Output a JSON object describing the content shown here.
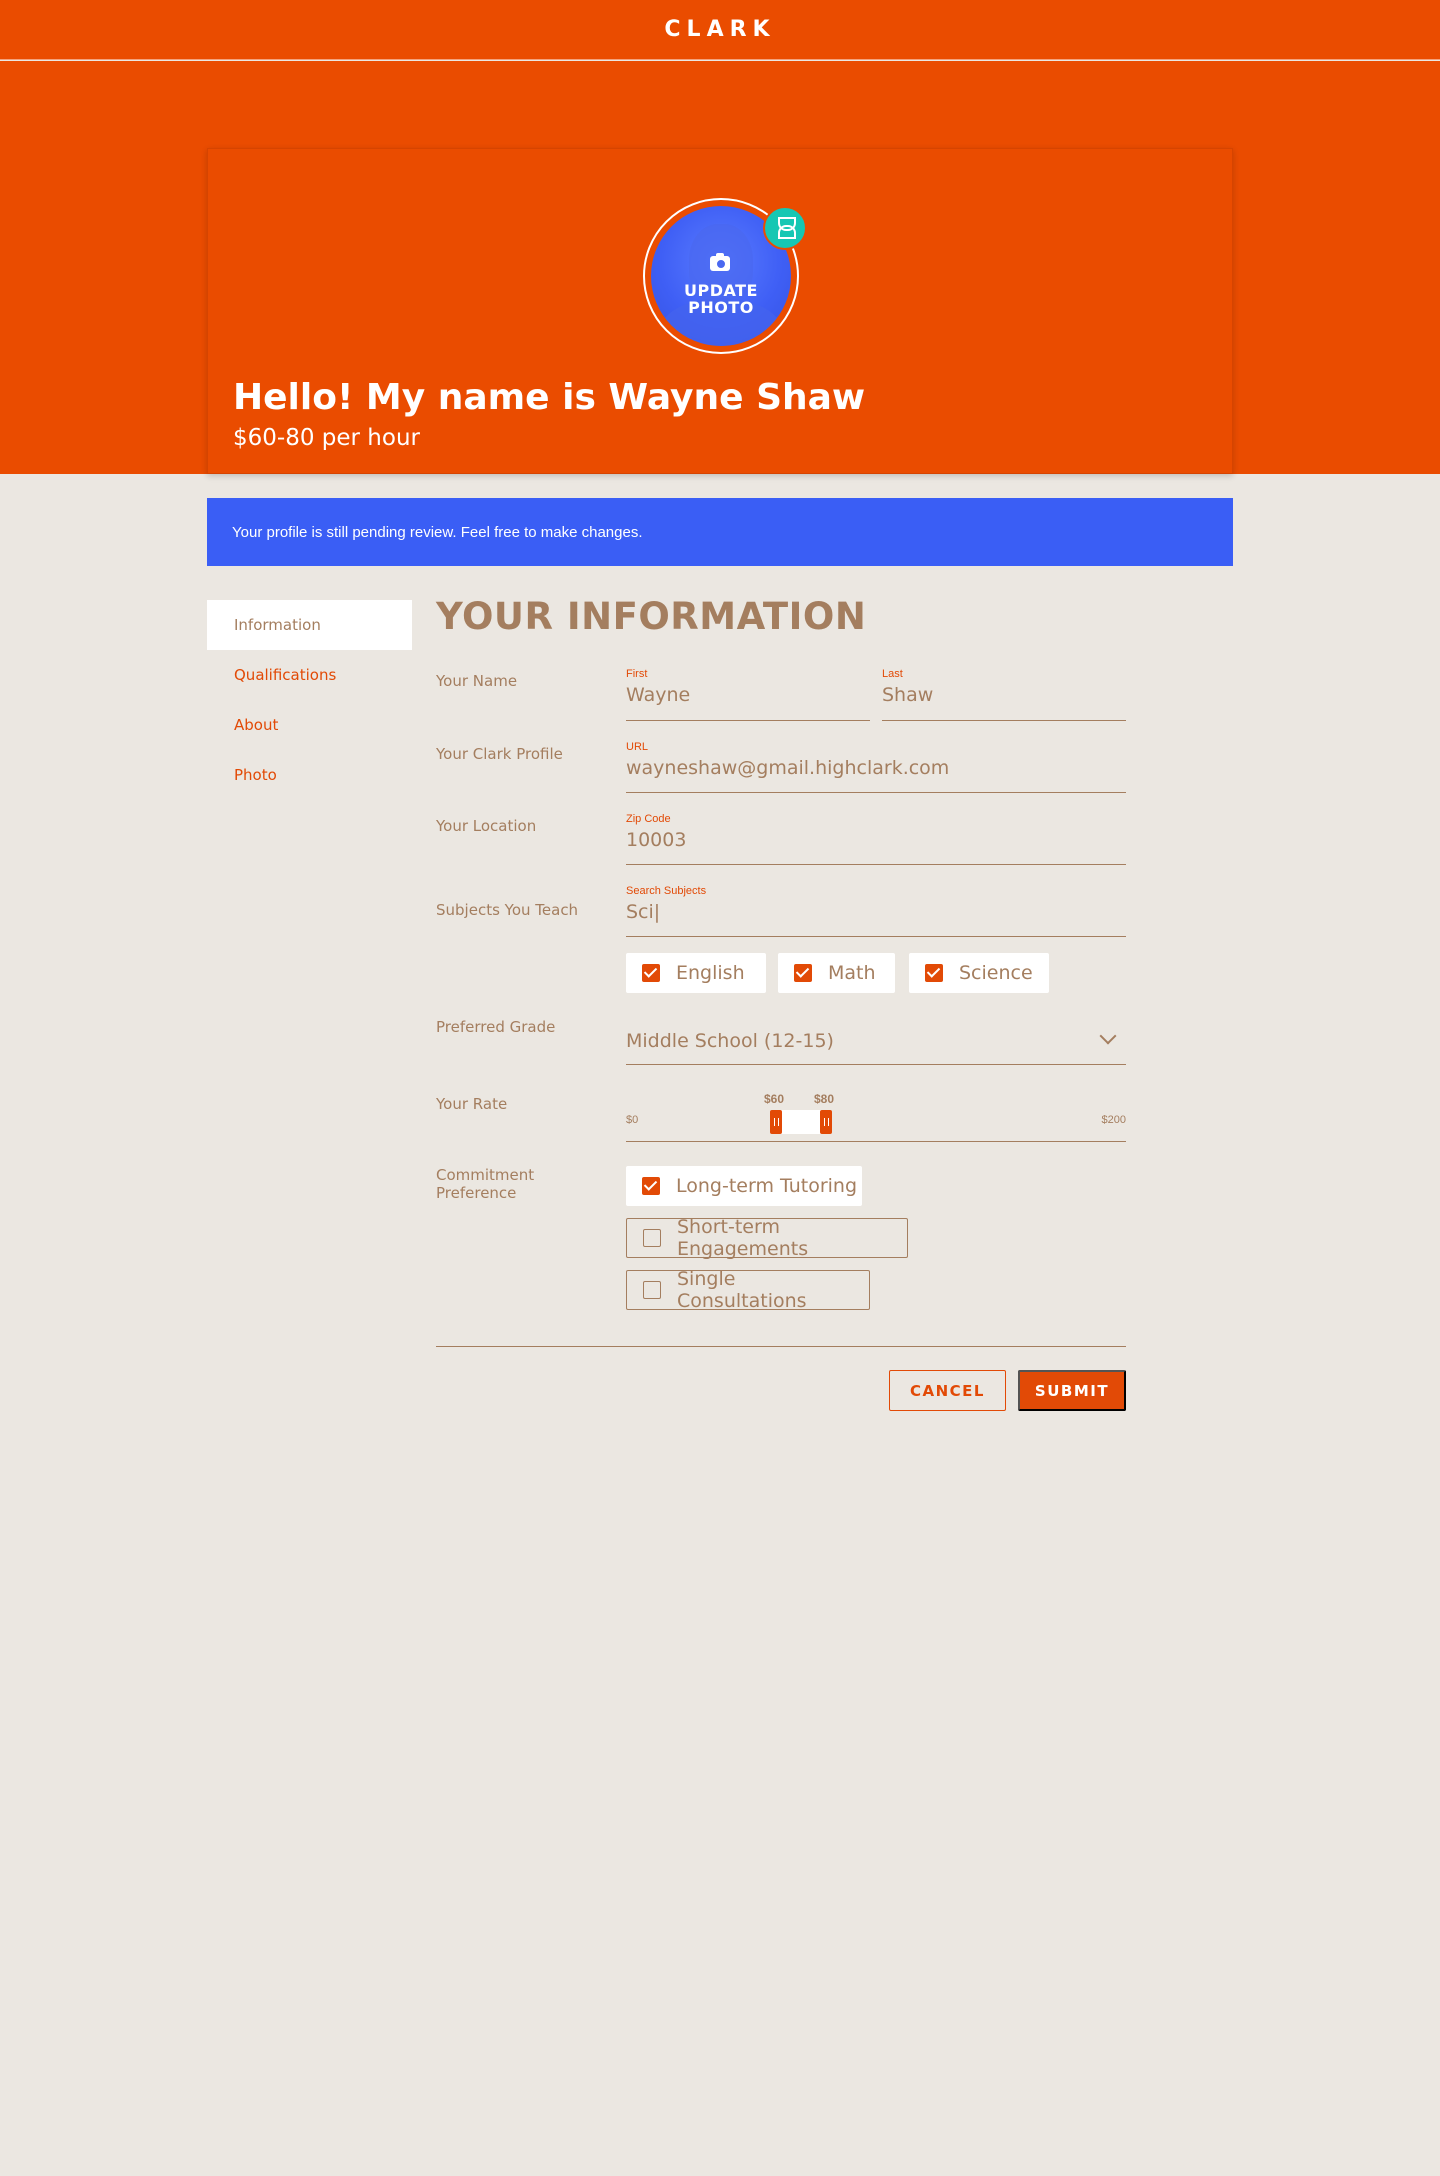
{
  "app": {
    "brand": "CLARK"
  },
  "hero": {
    "update_photo_line1": "UPDATE",
    "update_photo_line2": "PHOTO",
    "greeting": "Hello! My name is Wayne Shaw",
    "rate": "$60-80 per hour"
  },
  "notice": {
    "text": "Your profile is still pending review. Feel free to make changes."
  },
  "sidebar": {
    "items": [
      {
        "label": "Information",
        "active": true
      },
      {
        "label": "Qualifications",
        "active": false
      },
      {
        "label": "About",
        "active": false
      },
      {
        "label": "Photo",
        "active": false
      }
    ]
  },
  "form": {
    "title": "YOUR INFORMATION",
    "name": {
      "label": "Your Name",
      "first_label": "First",
      "first_value": "Wayne",
      "last_label": "Last",
      "last_value": "Shaw"
    },
    "profile": {
      "label": "Your Clark Profile",
      "url_label": "URL",
      "url_value": "wayneshaw@gmail.highclark.com"
    },
    "location": {
      "label": "Your Location",
      "zip_label": "Zip Code",
      "zip_value": "10003"
    },
    "subjects": {
      "label": "Subjects You Teach",
      "search_label": "Search Subjects",
      "search_value": "Sci|",
      "selected": [
        {
          "label": "English",
          "checked": true
        },
        {
          "label": "Math",
          "checked": true
        },
        {
          "label": "Science",
          "checked": true
        }
      ]
    },
    "grade": {
      "label": "Preferred Grade",
      "value": "Middle School (12-15)"
    },
    "rate": {
      "label": "Your Rate",
      "min_label": "$0",
      "max_label": "$200",
      "low_label": "$60",
      "high_label": "$80",
      "min": 0,
      "max": 200,
      "low": 60,
      "high": 80
    },
    "commitment": {
      "label_line1": "Commitment",
      "label_line2": "Preference",
      "options": [
        {
          "label": "Long-term Tutoring",
          "checked": true
        },
        {
          "label": "Short-term Engagements",
          "checked": false
        },
        {
          "label": "Single Consultations",
          "checked": false
        }
      ]
    },
    "actions": {
      "cancel": "CANCEL",
      "submit": "SUBMIT"
    }
  },
  "colors": {
    "brand": "#ea4c00",
    "accent": "#e24a06",
    "info": "#3a5ef5",
    "badge": "#16c7b3",
    "text": "#a47e5f",
    "background": "#ebe7e1"
  }
}
